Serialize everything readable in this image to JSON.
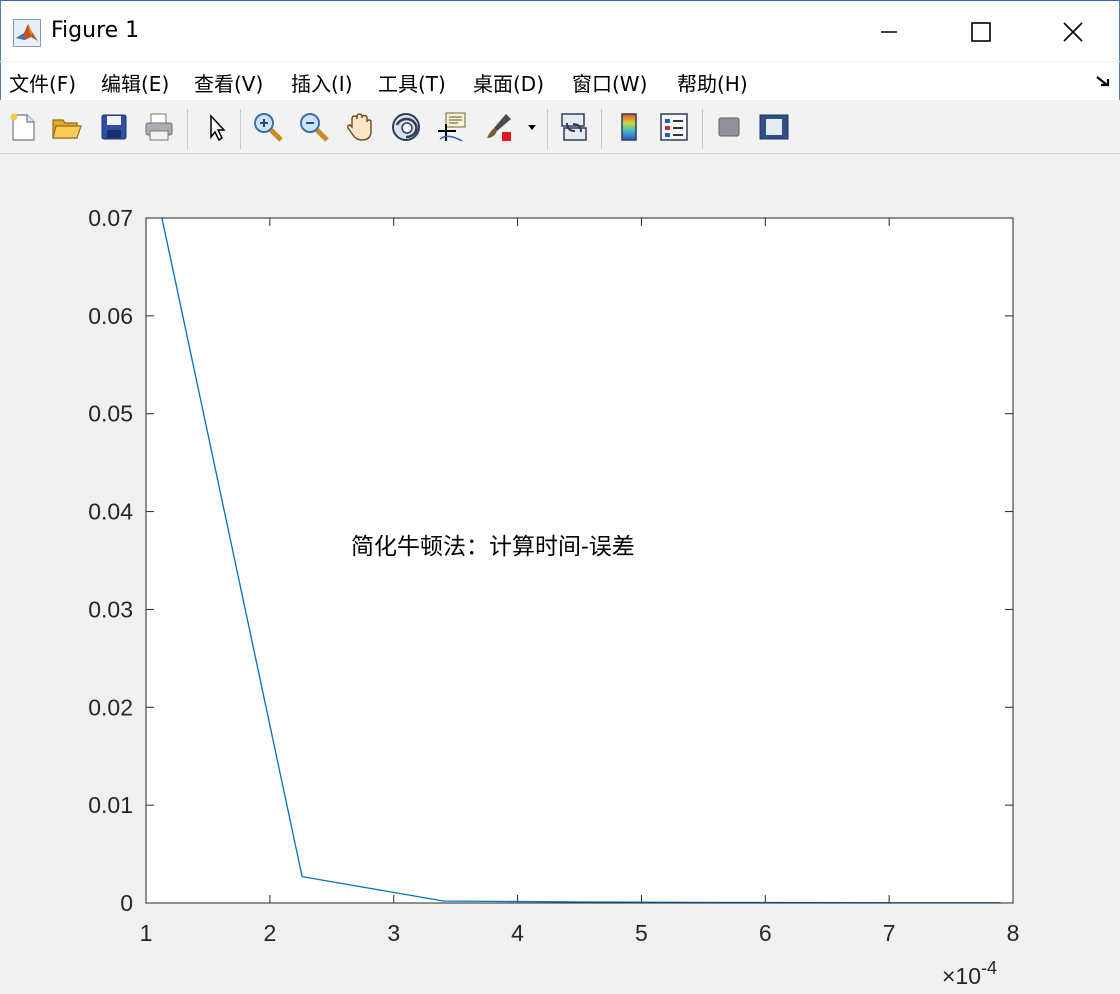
{
  "window": {
    "title": "Figure 1",
    "icon": "matlab-icon",
    "controls": [
      "minimize-icon",
      "maximize-icon",
      "close-icon"
    ]
  },
  "menu": {
    "items": [
      "文件(F)",
      "编辑(E)",
      "查看(V)",
      "插入(I)",
      "工具(T)",
      "桌面(D)",
      "窗口(W)",
      "帮助(H)"
    ],
    "dock_icon": "dock-arrow-icon"
  },
  "toolbar": {
    "icons": [
      "new-figure-icon",
      "open-file-icon",
      "save-icon",
      "print-icon",
      "edit-plot-arrow-icon",
      "zoom-in-icon",
      "zoom-out-icon",
      "pan-hand-icon",
      "rotate-3d-icon",
      "data-cursor-icon",
      "brush-icon",
      "brush-dropdown-icon",
      "link-plot-icon",
      "colorbar-icon",
      "legend-icon",
      "hide-plot-tools-icon",
      "show-plot-tools-icon"
    ]
  },
  "chart_data": {
    "type": "line",
    "title": "",
    "xlabel": "",
    "ylabel": "",
    "annotation": "简化牛顿法：计算时间-误差",
    "x_exponent_label": "×10",
    "x_exponent": "-4",
    "xlim": [
      1,
      8
    ],
    "ylim": [
      0,
      0.07
    ],
    "xticks": [
      "1",
      "2",
      "3",
      "4",
      "5",
      "6",
      "7",
      "8"
    ],
    "yticks": [
      "0",
      "0.01",
      "0.02",
      "0.03",
      "0.04",
      "0.05",
      "0.06",
      "0.07"
    ],
    "grid": false,
    "line_color": "#0072bd",
    "x": [
      1.12,
      2.26,
      3.4,
      4.54,
      5.68,
      6.82,
      7.9
    ],
    "series": [
      {
        "values": [
          0.0705,
          0.0027,
          0.0002,
          0.0001,
          5e-05,
          3e-05,
          2e-05
        ]
      }
    ]
  }
}
